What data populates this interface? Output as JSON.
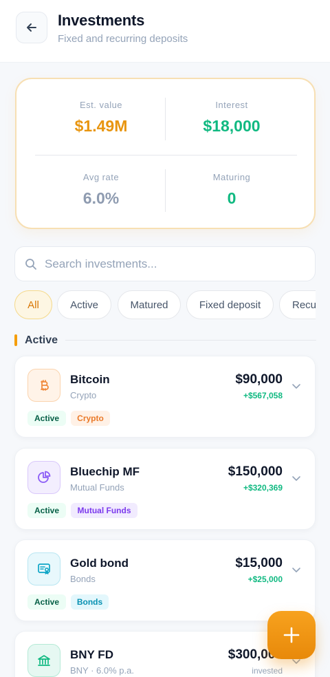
{
  "header": {
    "title": "Investments",
    "subtitle": "Fixed and recurring deposits"
  },
  "summary": {
    "est_value": {
      "label": "Est. value",
      "value": "$1.49M"
    },
    "interest": {
      "label": "Interest",
      "value": "$18,000"
    },
    "avg_rate": {
      "label": "Avg rate",
      "value": "6.0%"
    },
    "maturing": {
      "label": "Maturing",
      "value": "0"
    }
  },
  "search": {
    "placeholder": "Search investments..."
  },
  "filters": [
    "All",
    "Active",
    "Matured",
    "Fixed deposit",
    "Recurring"
  ],
  "section": {
    "title": "Active"
  },
  "investments": [
    {
      "name": "Bitcoin",
      "category": "Crypto",
      "amount": "$90,000",
      "gain": "+$567,058",
      "status": "Active",
      "tag": "Crypto",
      "icon": "bitcoin-icon"
    },
    {
      "name": "Bluechip MF",
      "category": "Mutual Funds",
      "amount": "$150,000",
      "gain": "+$320,369",
      "status": "Active",
      "tag": "Mutual Funds",
      "icon": "pie-chart-icon"
    },
    {
      "name": "Gold bond",
      "category": "Bonds",
      "amount": "$15,000",
      "gain": "+$25,000",
      "status": "Active",
      "tag": "Bonds",
      "icon": "certificate-icon"
    },
    {
      "name": "BNY FD",
      "category": "BNY · 6.0% p.a.",
      "amount": "$300,000",
      "gain": "invested",
      "icon": "bank-icon"
    }
  ],
  "colors": {
    "accent": "#f59e0b",
    "success": "#10b981",
    "muted": "#94a3b8"
  }
}
